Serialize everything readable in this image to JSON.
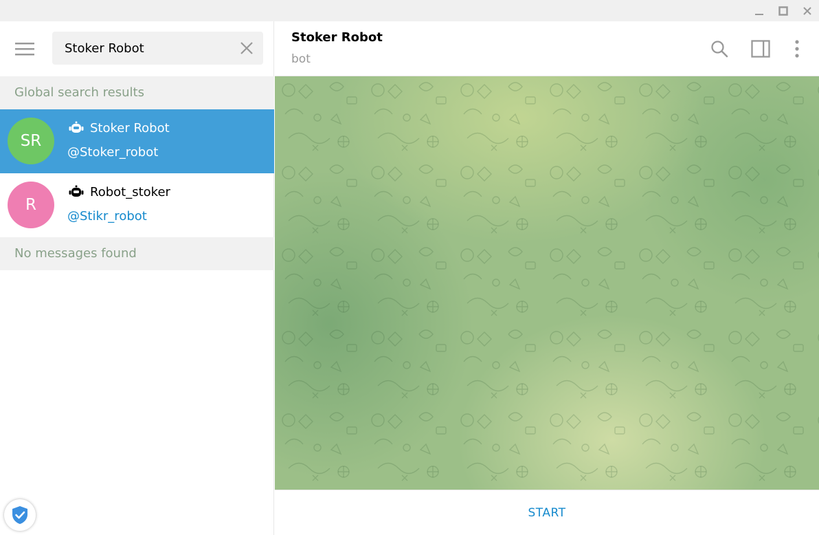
{
  "window": {
    "controls": [
      "minimize-icon",
      "maximize-icon",
      "close-icon"
    ]
  },
  "sidebar": {
    "menu_icon": "hamburger-icon",
    "search": {
      "value": "Stoker Robot",
      "clear_icon": "close-icon"
    },
    "global_header": "Global search results",
    "results": [
      {
        "initials": "SR",
        "avatar_color": "#6ec764",
        "name": "Stoker Robot",
        "handle": "@Stoker_robot",
        "icon": "bot-icon",
        "selected": true
      },
      {
        "initials": "R",
        "avatar_color": "#ef7eb2",
        "name": "Robot_stoker",
        "handle": "@Stikr_robot",
        "icon": "bot-icon",
        "selected": false
      }
    ],
    "messages_header": "No messages found",
    "shield_icon": "shield-check-icon"
  },
  "chat": {
    "title": "Stoker Robot",
    "status": "bot",
    "header_icons": [
      "search-icon",
      "sidebar-toggle-icon",
      "more-vertical-icon"
    ],
    "start_label": "START"
  },
  "colors": {
    "accent": "#419fd9",
    "link": "#168acd",
    "section_text": "#89a189"
  }
}
